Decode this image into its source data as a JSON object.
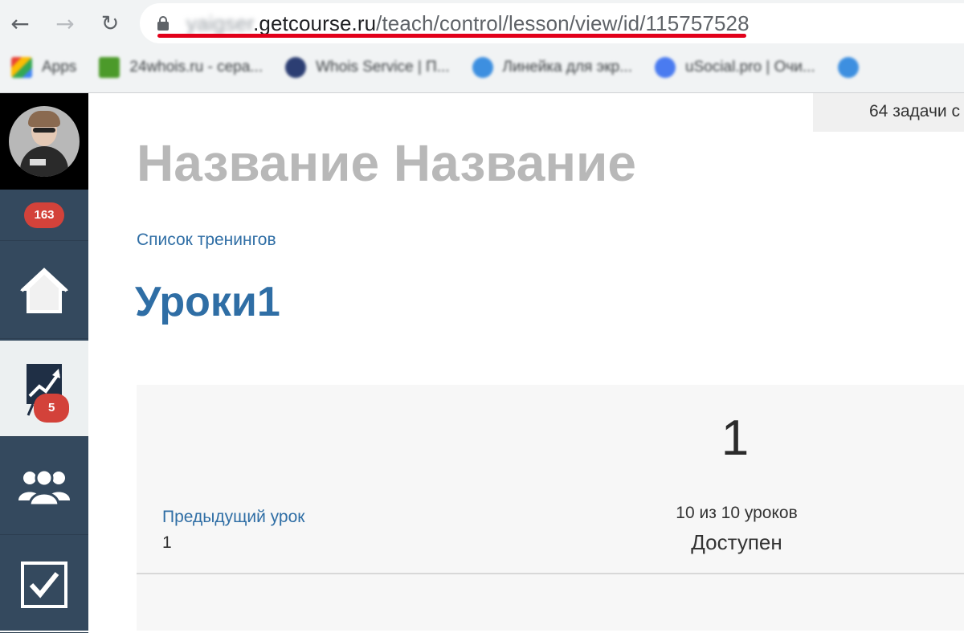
{
  "browser": {
    "url_host_blurred": "yaigser",
    "url_host": ".getcourse.ru",
    "url_path": "/teach/control/lesson/view/id/115757528",
    "bookmarks": [
      {
        "label": "Apps",
        "icon": "apps-grid-icon",
        "color": "#e8a33d"
      },
      {
        "label": "24whois.ru - сера...",
        "icon": "24whois-icon",
        "color": "#4c9a2a"
      },
      {
        "label": "Whois Service | П...",
        "icon": "whois-service-icon",
        "color": "#2c3e73"
      },
      {
        "label": "Линейка для экр...",
        "icon": "ruler-icon",
        "color": "#3d8fe0"
      },
      {
        "label": "uSocial.pro | Очи...",
        "icon": "usocial-icon",
        "color": "#4a7bf0"
      },
      {
        "label": "",
        "icon": "bookmark-icon",
        "color": "#3d8fe0"
      }
    ]
  },
  "sidebar": {
    "notifications_count": "163",
    "stats_badge": "5",
    "items": [
      {
        "name": "home",
        "icon": "home-icon"
      },
      {
        "name": "stats",
        "icon": "chart-board-icon"
      },
      {
        "name": "users",
        "icon": "users-group-icon"
      },
      {
        "name": "tasks",
        "icon": "checkbox-icon"
      }
    ]
  },
  "header": {
    "tasks_text": "64 задачи с"
  },
  "main": {
    "page_title": "Название Название",
    "breadcrumb": "Список тренингов",
    "section_title": "Уроки1",
    "lesson": {
      "prev_link": "Предыдущий урок",
      "prev_num": "1",
      "current_num": "1",
      "count_text": "10 из 10 уроков",
      "status": "Доступен"
    }
  },
  "colors": {
    "sidebar_bg": "#34495e",
    "badge_bg": "#d3423a",
    "link": "#2f6ea5",
    "url_underline": "#e2001a"
  }
}
